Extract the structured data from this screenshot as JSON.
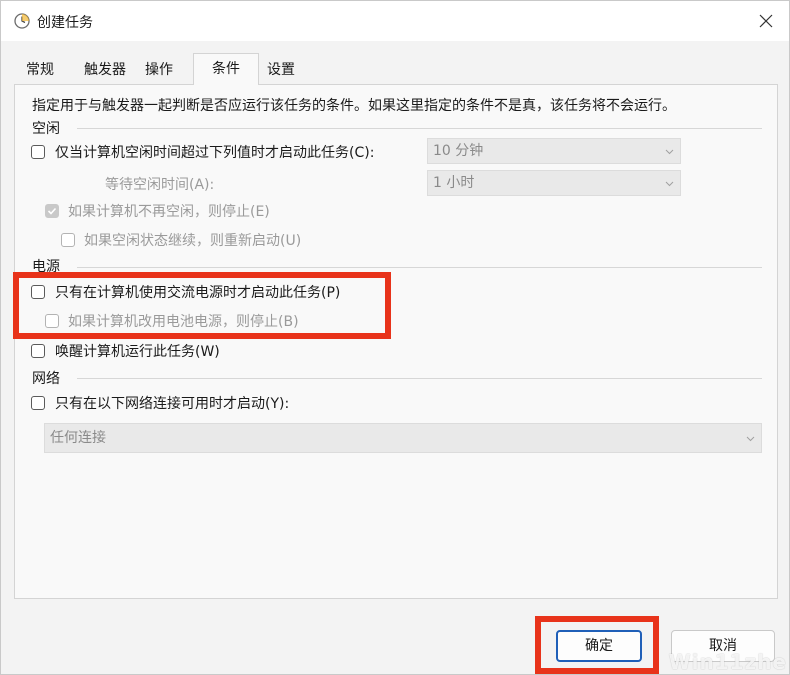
{
  "window": {
    "title": "创建任务"
  },
  "tabs": [
    {
      "label": "常规",
      "active": false
    },
    {
      "label": "触发器",
      "active": false
    },
    {
      "label": "操作",
      "active": false
    },
    {
      "label": "条件",
      "active": true
    },
    {
      "label": "设置",
      "active": false
    }
  ],
  "conditions": {
    "description": "指定用于与触发器一起判断是否应运行该任务的条件。如果这里指定的条件不是真，该任务将不会运行。",
    "idle": {
      "section_label": "空闲",
      "start_if_idle_label": "仅当计算机空闲时间超过下列值时才启动此任务(C):",
      "start_if_idle_checked": false,
      "idle_duration_value": "10 分钟",
      "wait_label": "等待空闲时间(A):",
      "wait_value": "1 小时",
      "stop_if_not_idle_label": "如果计算机不再空闲，则停止(E)",
      "stop_if_not_idle_checked": true,
      "restart_if_idle_resumes_label": "如果空闲状态继续，则重新启动(U)",
      "restart_if_idle_resumes_checked": false
    },
    "power": {
      "section_label": "电源",
      "ac_only_label": "只有在计算机使用交流电源时才启动此任务(P)",
      "ac_only_checked": false,
      "stop_on_battery_label": "如果计算机改用电池电源，则停止(B)",
      "stop_on_battery_checked": false,
      "wake_label": "唤醒计算机运行此任务(W)",
      "wake_checked": false
    },
    "network": {
      "section_label": "网络",
      "network_only_label": "只有在以下网络连接可用时才启动(Y):",
      "network_only_checked": false,
      "connection_value": "任何连接"
    }
  },
  "footer": {
    "ok_label": "确定",
    "cancel_label": "取消"
  },
  "watermark": "Win11zhe",
  "colors": {
    "highlight_box": "#e8331a",
    "primary_border": "#1f5fb8"
  }
}
